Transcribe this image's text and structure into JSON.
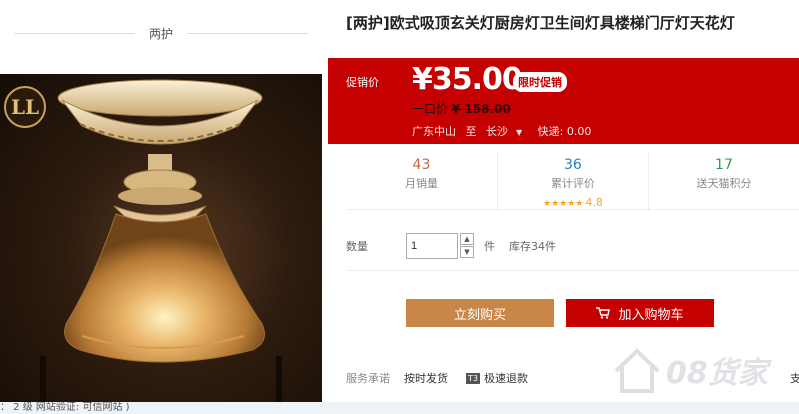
{
  "shop": {
    "tag": "两护"
  },
  "product": {
    "title": "[两护]欧式吸顶玄关灯厨房灯卫生间灯具楼梯门厅灯天花灯",
    "logo_text": "LL"
  },
  "price": {
    "label": "促销价",
    "value": "¥35.00",
    "promo_badge": "限时促销",
    "original_label": "一口价",
    "original_value": "¥ 158.00",
    "from": "广东中山",
    "to_word": "至",
    "to": "长沙",
    "shipping": "快递: 0.00"
  },
  "stats": [
    {
      "num": "43",
      "label": "月销量",
      "color": "#c46a3c"
    },
    {
      "num": "36",
      "label": "累计评价",
      "color": "#2a7fb8",
      "stars": "★★★★★",
      "score": "4.8"
    },
    {
      "num": "17",
      "label": "送天猫积分",
      "color": "#2aa04a"
    }
  ],
  "quantity": {
    "label": "数量",
    "value": "1",
    "unit": "件",
    "stock": "库存34件"
  },
  "buttons": {
    "buy_now": "立刻购买",
    "add_to_cart": "加入购物车"
  },
  "service": {
    "label": "服务承诺",
    "items": [
      "按时发货",
      "极速退款"
    ],
    "badge": "T3",
    "edge": "支"
  },
  "footer": {
    "text": "： 2 级 网站验证: 可信网站 )"
  },
  "watermark": {
    "text": "08货家"
  },
  "colors": {
    "accent_red": "#c40000",
    "buy_orange": "#c88748"
  }
}
